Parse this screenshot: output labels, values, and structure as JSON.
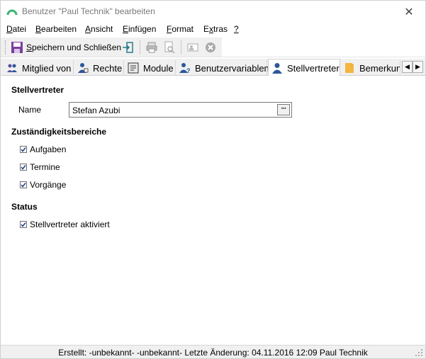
{
  "window": {
    "title": "Benutzer \"Paul Technik\" bearbeiten",
    "close_glyph": "✕"
  },
  "menu": {
    "items": [
      {
        "label": "Datei",
        "accel": "D",
        "rest": "atei"
      },
      {
        "label": "Bearbeiten",
        "accel": "B",
        "rest": "earbeiten"
      },
      {
        "label": "Ansicht",
        "accel": "A",
        "rest": "nsicht"
      },
      {
        "label": "Einfügen",
        "accel": "E",
        "rest": "infügen"
      },
      {
        "label": "Format",
        "accel": "F",
        "rest": "ormat"
      },
      {
        "label": "Extras",
        "accel": "x",
        "rest_prefix": "E",
        "rest": "tras"
      },
      {
        "label": "?",
        "accel": "?",
        "rest": ""
      }
    ]
  },
  "toolbar": {
    "save_close_label": "Speichern und Schließen",
    "save_close_accel": "S",
    "save_close_rest": "peichern und Schließen"
  },
  "tabs": [
    {
      "label": "Mitglied von",
      "icon": "group-icon"
    },
    {
      "label": "Rechte",
      "icon": "rights-icon"
    },
    {
      "label": "Module",
      "icon": "module-icon"
    },
    {
      "label": "Benutzervariablen",
      "icon": "user-variables-icon"
    },
    {
      "label": "Stellvertreter",
      "icon": "user-icon",
      "active": true
    },
    {
      "label": "Bemerkung",
      "icon": "note-icon"
    }
  ],
  "tab_scroll": {
    "left": "◀",
    "right": "▶"
  },
  "stellvertreter": {
    "heading": "Stellvertreter",
    "name_label": "Name",
    "name_value": "Stefan Azubi",
    "ellipsis": "···"
  },
  "zustaendigkeit": {
    "heading": "Zuständigkeitsbereiche",
    "items": [
      {
        "label": "Aufgaben",
        "checked": true
      },
      {
        "label": "Termine",
        "checked": true
      },
      {
        "label": "Vorgänge",
        "checked": true
      }
    ]
  },
  "status": {
    "heading": "Status",
    "activated_label": "Stellvertreter aktiviert",
    "activated_checked": true
  },
  "statusbar": {
    "text": "Erstellt: -unbekannt- -unbekannt-  Letzte Änderung: 04.11.2016 12:09 Paul Technik"
  },
  "colors": {
    "accent": "#2b579a",
    "title_icon": "#3cb371"
  }
}
